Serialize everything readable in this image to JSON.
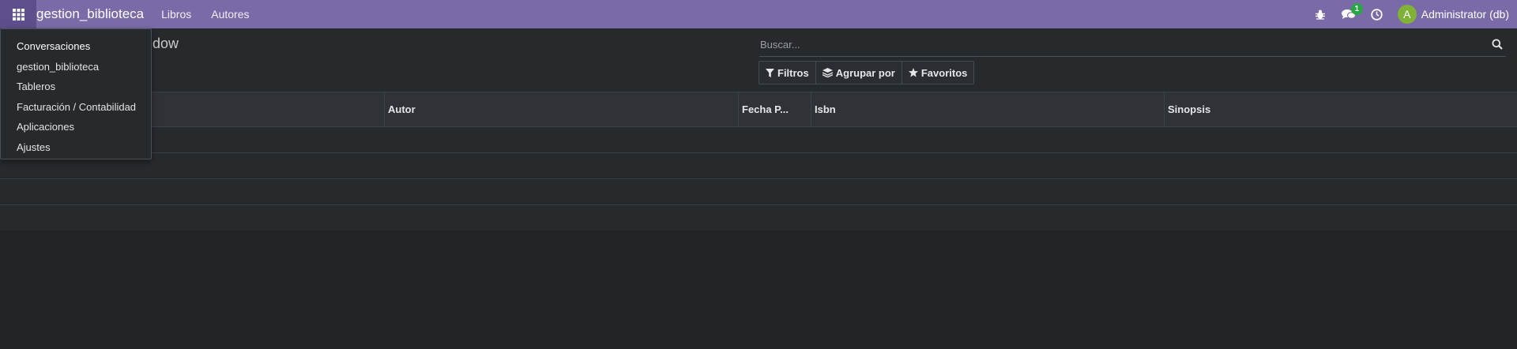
{
  "navbar": {
    "brand": "gestion_biblioteca",
    "menu": [
      "Libros",
      "Autores"
    ],
    "icons": {
      "apps": "grid-icon",
      "debug": "bug-icon",
      "messages": "chat-icon",
      "activities": "clock-icon"
    },
    "messages_badge": "1",
    "user_initial": "A",
    "user_name": "Administrator (db)",
    "colors": {
      "bar": "#7a6aa8",
      "avatar": "#7fb236",
      "badge": "#28a745"
    }
  },
  "control_panel": {
    "title_visible_part": "dow",
    "search": {
      "placeholder": "Buscar...",
      "value": ""
    },
    "buttons": {
      "filters": "Filtros",
      "group_by": "Agrupar por",
      "favorites": "Favoritos"
    }
  },
  "table": {
    "columns": [
      "Autor",
      "Fecha P...",
      "Isbn",
      "Sinopsis"
    ],
    "empty_rows": 4
  },
  "apps_menu": {
    "items": [
      "Conversaciones",
      "gestion_biblioteca",
      "Tableros",
      "Facturación / Contabilidad",
      "Aplicaciones",
      "Ajustes"
    ]
  }
}
